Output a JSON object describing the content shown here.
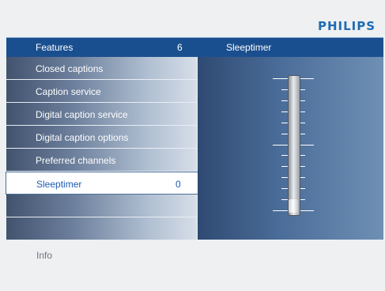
{
  "brand": "PHILIPS",
  "header": {
    "menu_title": "Features",
    "item_count": "6",
    "submenu_title": "Sleeptimer"
  },
  "menu": {
    "items": [
      {
        "label": "Closed captions",
        "value": ""
      },
      {
        "label": "Caption service",
        "value": ""
      },
      {
        "label": "Digital caption service",
        "value": ""
      },
      {
        "label": "Digital caption options",
        "value": ""
      },
      {
        "label": "Preferred channels",
        "value": ""
      },
      {
        "label": "Sleeptimer",
        "value": "0",
        "selected": true
      }
    ]
  },
  "slider": {
    "name": "sleeptimer-slider",
    "level": 0
  },
  "footer": {
    "info_label": "Info"
  },
  "colors": {
    "brand": "#1f6db3",
    "header_bar": "#1a4f8f",
    "selected_text": "#1a5bb5",
    "background": "#eef0f2"
  }
}
